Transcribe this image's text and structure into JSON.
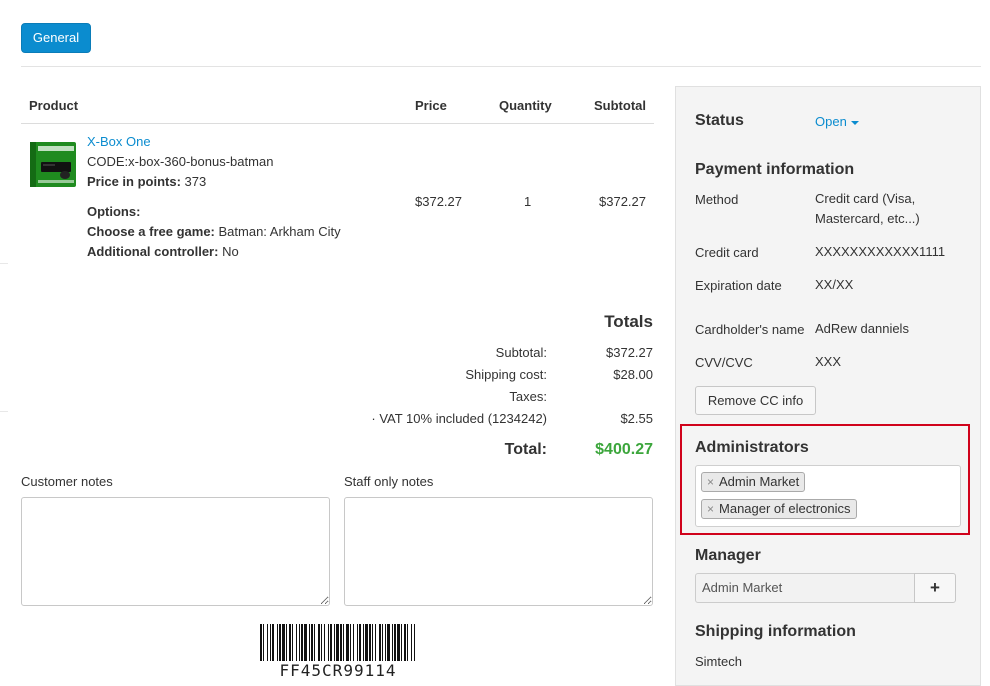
{
  "tabs": {
    "general": "General"
  },
  "products": {
    "headers": {
      "product": "Product",
      "price": "Price",
      "quantity": "Quantity",
      "subtotal": "Subtotal"
    },
    "item": {
      "name": "X-Box One",
      "code": "CODE:x-box-360-bonus-batman",
      "points_label": "Price in points:",
      "points_value": "373",
      "options_label": "Options:",
      "option1_label": "Choose a free game:",
      "option1_value": "Batman: Arkham City",
      "option2_label": "Additional controller:",
      "option2_value": "No",
      "price": "$372.27",
      "quantity": "1",
      "subtotal": "$372.27"
    }
  },
  "totals": {
    "heading": "Totals",
    "subtotal_label": "Subtotal:",
    "subtotal_value": "$372.27",
    "shipping_label": "Shipping cost:",
    "shipping_value": "$28.00",
    "taxes_label": "Taxes:",
    "vat_label": "· VAT 10% included (1234242)",
    "vat_value": "$2.55",
    "total_label": "Total:",
    "total_value": "$400.27",
    "total_color": "#3ca63c"
  },
  "notes": {
    "customer_label": "Customer notes",
    "staff_label": "Staff only notes"
  },
  "barcode": {
    "text": "FF45CR99114"
  },
  "sidebar": {
    "status_label": "Status",
    "status_value": "Open",
    "payment_heading": "Payment information",
    "method_label": "Method",
    "method_value": "Credit card (Visa, Mastercard, etc...)",
    "card_label": "Credit card",
    "card_value": "XXXXXXXXXXXX1111",
    "exp_label": "Expiration date",
    "exp_value": "XX/XX",
    "holder_label": "Cardholder's name",
    "holder_value": "AdRew danniels",
    "cvv_label": "CVV/CVC",
    "cvv_value": "XXX",
    "remove_cc_button": "Remove CC info",
    "admins_heading": "Administrators",
    "admins": [
      "Admin Market",
      "Manager of electronics"
    ],
    "manager_heading": "Manager",
    "manager_value": "Admin Market",
    "manager_add": "+",
    "shipping_heading": "Shipping information",
    "shipping_value": "Simtech"
  },
  "colors": {
    "accent": "#0b8ccf",
    "highlight": "#d0021b"
  }
}
